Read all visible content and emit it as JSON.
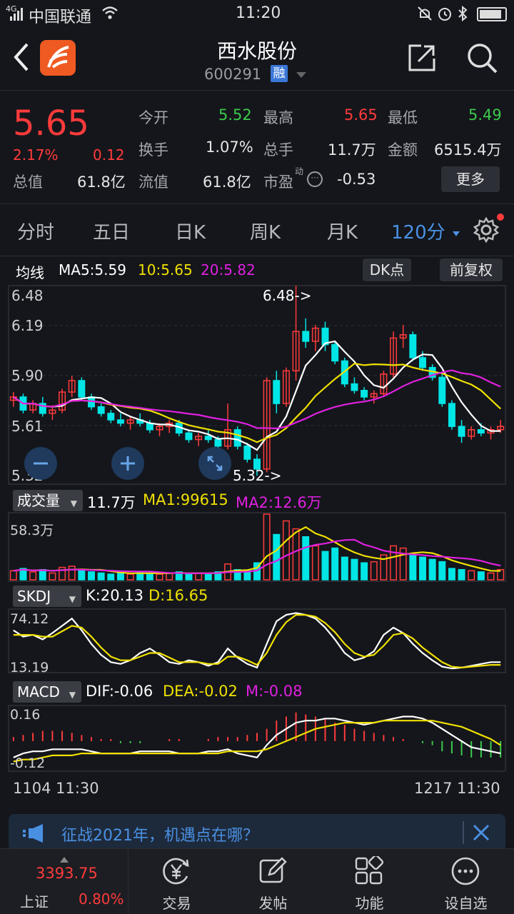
{
  "status": {
    "network": "4G",
    "carrier": "中国联通",
    "time": "11:20"
  },
  "header": {
    "stock_name": "西水股份",
    "stock_code": "600291",
    "margin_badge": "融"
  },
  "quote": {
    "price": "5.65",
    "change_pct": "2.17%",
    "change_amt": "0.12",
    "total_cap_label": "总值",
    "total_cap": "61.8亿",
    "fields": [
      {
        "label": "今开",
        "value": "5.52",
        "color": "#3cc94c"
      },
      {
        "label": "最高",
        "value": "5.65",
        "color": "#ff3b3b"
      },
      {
        "label": "最低",
        "value": "5.49",
        "color": "#3cc94c"
      },
      {
        "label": "换手",
        "value": "1.07%",
        "color": "#ffffff"
      },
      {
        "label": "总手",
        "value": "11.7万",
        "color": "#ffffff"
      },
      {
        "label": "金额",
        "value": "6515.4万",
        "color": "#ffffff"
      },
      {
        "label": "流值",
        "value": "61.8亿",
        "color": "#ffffff"
      },
      {
        "label": "市盈",
        "value": "-0.53",
        "color": "#ffffff"
      }
    ],
    "pe_superscript": "动",
    "more_label": "更多"
  },
  "tabs": [
    "分时",
    "五日",
    "日K",
    "周K",
    "月K",
    "120分"
  ],
  "kline_header": {
    "ma_label": "均线",
    "ma5": "MA5:5.59",
    "ma10": "10:5.65",
    "ma20": "20:5.82",
    "dk_button": "DK点",
    "adjust_button": "前复权"
  },
  "kline_axis": [
    "6.48",
    "6.19",
    "5.90",
    "5.61",
    "5.32"
  ],
  "kline_marks": {
    "high": "6.48->",
    "low": "5.32->"
  },
  "volume_header": {
    "selector": "成交量",
    "value": "11.7万",
    "ma1": "MA1:99615",
    "ma2": "MA2:12.6万",
    "axis_top": "58.3万"
  },
  "kdj_header": {
    "selector": "SKDJ",
    "k": "K:20.13",
    "d": "D:16.65",
    "axis_top": "74.12",
    "axis_bottom": "13.19"
  },
  "macd_header": {
    "selector": "MACD",
    "dif": "DIF:-0.06",
    "dea": "DEA:-0.02",
    "m": "M:-0.08",
    "axis_top": "0.16",
    "axis_bottom": "-0.12"
  },
  "time_axis": {
    "start": "1104 11:30",
    "end": "1217 11:30"
  },
  "banner": {
    "text": "征战2021年，机遇点在哪？"
  },
  "footer": {
    "index_value": "3393.75",
    "index_name": "上证",
    "index_change": "0.80%",
    "items": [
      "交易",
      "发帖",
      "功能",
      "设自选"
    ]
  },
  "colors": {
    "up": "#ff3b3b",
    "down": "#00e5e5",
    "ma5": "#ffffff",
    "ma10": "#f0e000",
    "ma20": "#e020e0",
    "accent": "#4a90e2"
  },
  "chart_data": {
    "type": "candlestick",
    "y_range": [
      5.32,
      6.48
    ],
    "candles": [
      [
        5.78,
        5.83,
        5.74,
        5.8
      ],
      [
        5.8,
        5.82,
        5.7,
        5.72
      ],
      [
        5.72,
        5.78,
        5.7,
        5.76
      ],
      [
        5.76,
        5.8,
        5.68,
        5.7
      ],
      [
        5.7,
        5.75,
        5.66,
        5.72
      ],
      [
        5.72,
        5.85,
        5.7,
        5.83
      ],
      [
        5.83,
        5.93,
        5.8,
        5.9
      ],
      [
        5.9,
        5.92,
        5.78,
        5.8
      ],
      [
        5.8,
        5.82,
        5.72,
        5.74
      ],
      [
        5.74,
        5.76,
        5.68,
        5.7
      ],
      [
        5.7,
        5.72,
        5.64,
        5.66
      ],
      [
        5.66,
        5.7,
        5.62,
        5.64
      ],
      [
        5.64,
        5.68,
        5.6,
        5.66
      ],
      [
        5.66,
        5.7,
        5.62,
        5.64
      ],
      [
        5.64,
        5.66,
        5.58,
        5.6
      ],
      [
        5.6,
        5.64,
        5.56,
        5.62
      ],
      [
        5.62,
        5.66,
        5.58,
        5.64
      ],
      [
        5.64,
        5.66,
        5.56,
        5.58
      ],
      [
        5.58,
        5.6,
        5.52,
        5.54
      ],
      [
        5.54,
        5.58,
        5.5,
        5.56
      ],
      [
        5.56,
        5.6,
        5.52,
        5.54
      ],
      [
        5.54,
        5.56,
        5.48,
        5.5
      ],
      [
        5.5,
        5.76,
        5.48,
        5.6
      ],
      [
        5.6,
        5.62,
        5.48,
        5.5
      ],
      [
        5.5,
        5.52,
        5.4,
        5.42
      ],
      [
        5.42,
        5.45,
        5.32,
        5.36
      ],
      [
        5.36,
        5.92,
        5.34,
        5.9
      ],
      [
        5.9,
        5.96,
        5.7,
        5.76
      ],
      [
        5.76,
        5.98,
        5.74,
        5.96
      ],
      [
        5.96,
        6.48,
        5.9,
        6.2
      ],
      [
        6.2,
        6.28,
        6.1,
        6.14
      ],
      [
        6.14,
        6.24,
        6.08,
        6.22
      ],
      [
        6.22,
        6.26,
        6.08,
        6.12
      ],
      [
        6.12,
        6.14,
        6.0,
        6.02
      ],
      [
        6.02,
        6.04,
        5.86,
        5.88
      ],
      [
        5.88,
        5.92,
        5.82,
        5.84
      ],
      [
        5.84,
        5.86,
        5.78,
        5.8
      ],
      [
        5.8,
        5.84,
        5.76,
        5.82
      ],
      [
        5.82,
        5.96,
        5.8,
        5.94
      ],
      [
        5.94,
        6.2,
        5.92,
        6.16
      ],
      [
        6.16,
        6.24,
        6.1,
        6.18
      ],
      [
        6.18,
        6.2,
        6.02,
        6.04
      ],
      [
        6.04,
        6.08,
        5.96,
        5.98
      ],
      [
        5.98,
        6.0,
        5.9,
        5.92
      ],
      [
        5.92,
        5.94,
        5.74,
        5.76
      ],
      [
        5.76,
        5.78,
        5.6,
        5.62
      ],
      [
        5.62,
        5.66,
        5.52,
        5.56
      ],
      [
        5.56,
        5.62,
        5.54,
        5.6
      ],
      [
        5.6,
        5.64,
        5.56,
        5.58
      ],
      [
        5.58,
        5.62,
        5.54,
        5.6
      ],
      [
        5.6,
        5.66,
        5.58,
        5.62
      ]
    ],
    "volumes": [
      8,
      10,
      7,
      9,
      6,
      11,
      12,
      8,
      7,
      6,
      5,
      6,
      5,
      7,
      6,
      5,
      6,
      7,
      5,
      6,
      5,
      7,
      14,
      9,
      8,
      15,
      58,
      40,
      52,
      45,
      38,
      30,
      25,
      28,
      20,
      18,
      15,
      16,
      22,
      30,
      28,
      22,
      20,
      18,
      16,
      10,
      9,
      8,
      7,
      6,
      9
    ],
    "kdj_k": [
      55,
      48,
      50,
      45,
      52,
      60,
      68,
      55,
      40,
      28,
      20,
      18,
      22,
      30,
      35,
      28,
      20,
      18,
      22,
      20,
      16,
      20,
      35,
      25,
      18,
      14,
      40,
      65,
      72,
      74,
      72,
      68,
      58,
      45,
      30,
      22,
      25,
      32,
      50,
      58,
      52,
      40,
      30,
      22,
      15,
      13,
      14,
      16,
      18,
      20,
      20
    ],
    "kdj_d": [
      50,
      50,
      50,
      48,
      48,
      54,
      60,
      58,
      48,
      36,
      26,
      22,
      22,
      26,
      30,
      30,
      25,
      20,
      20,
      20,
      18,
      18,
      26,
      26,
      22,
      17,
      30,
      50,
      64,
      72,
      72,
      70,
      63,
      53,
      40,
      30,
      26,
      28,
      38,
      50,
      52,
      46,
      36,
      28,
      20,
      15,
      14,
      15,
      16,
      17,
      17
    ],
    "macd_hist": [
      0.02,
      0.03,
      0.04,
      0.05,
      0.05,
      0.05,
      0.04,
      0.03,
      0.02,
      0.01,
      0.01,
      -0.01,
      -0.01,
      -0.01,
      0.0,
      0.0,
      0.01,
      0.01,
      0.0,
      0.0,
      0.01,
      0.02,
      0.02,
      0.02,
      0.03,
      0.04,
      0.06,
      0.1,
      0.12,
      0.14,
      0.13,
      0.12,
      0.11,
      0.09,
      0.08,
      0.06,
      0.05,
      0.04,
      0.03,
      0.02,
      0.01,
      0.0,
      -0.01,
      -0.02,
      -0.05,
      -0.06,
      -0.07,
      -0.08,
      -0.08,
      -0.08,
      -0.08
    ],
    "macd_dif": [
      -0.08,
      -0.06,
      -0.05,
      -0.05,
      -0.04,
      -0.04,
      -0.04,
      -0.04,
      -0.05,
      -0.06,
      -0.06,
      -0.06,
      -0.06,
      -0.05,
      -0.05,
      -0.05,
      -0.05,
      -0.06,
      -0.06,
      -0.06,
      -0.05,
      -0.05,
      -0.04,
      -0.06,
      -0.07,
      -0.08,
      -0.02,
      0.03,
      0.06,
      0.09,
      0.1,
      0.1,
      0.11,
      0.11,
      0.1,
      0.09,
      0.08,
      0.09,
      0.1,
      0.11,
      0.12,
      0.12,
      0.11,
      0.09,
      0.06,
      0.03,
      0.0,
      -0.03,
      -0.04,
      -0.05,
      -0.06
    ],
    "macd_dea": [
      -0.1,
      -0.09,
      -0.09,
      -0.08,
      -0.07,
      -0.07,
      -0.07,
      -0.06,
      -0.06,
      -0.06,
      -0.06,
      -0.06,
      -0.06,
      -0.06,
      -0.06,
      -0.06,
      -0.06,
      -0.06,
      -0.06,
      -0.06,
      -0.06,
      -0.06,
      -0.05,
      -0.05,
      -0.05,
      -0.05,
      -0.04,
      -0.02,
      0.0,
      0.02,
      0.04,
      0.06,
      0.07,
      0.08,
      0.09,
      0.09,
      0.09,
      0.09,
      0.1,
      0.1,
      0.1,
      0.1,
      0.1,
      0.1,
      0.09,
      0.08,
      0.07,
      0.05,
      0.03,
      0.01,
      -0.02
    ]
  }
}
